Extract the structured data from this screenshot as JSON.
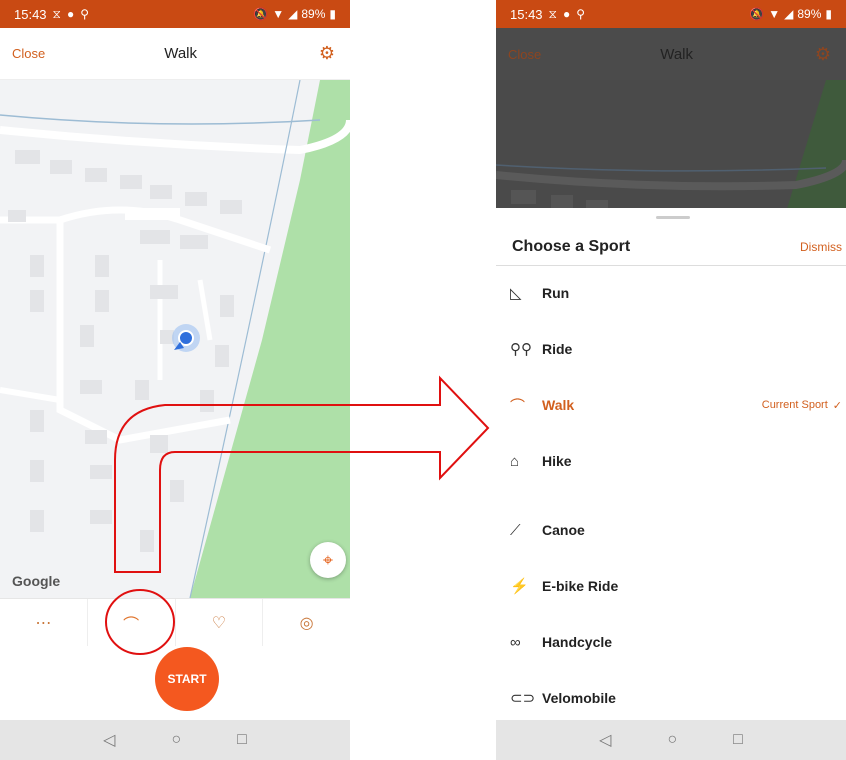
{
  "status_bar": {
    "time": "15:43",
    "battery": "89%"
  },
  "left_screen": {
    "header": {
      "close_label": "Close",
      "title": "Walk"
    },
    "map": {
      "attribution": "Google"
    },
    "start_label": "START"
  },
  "right_screen": {
    "header": {
      "close_label": "Close",
      "title": "Walk"
    },
    "sheet": {
      "title": "Choose a Sport",
      "dismiss_label": "Dismiss",
      "current_sport_label": "Current Sport",
      "sports": [
        {
          "label": "Run",
          "icon": "shoe-icon"
        },
        {
          "label": "Ride",
          "icon": "bike-icon"
        },
        {
          "label": "Walk",
          "icon": "walk-shoe-icon",
          "current": true
        },
        {
          "label": "Hike",
          "icon": "boot-icon"
        },
        {
          "label": "Canoe",
          "icon": "canoe-icon"
        },
        {
          "label": "E-bike Ride",
          "icon": "ebike-icon"
        },
        {
          "label": "Handcycle",
          "icon": "handcycle-icon"
        },
        {
          "label": "Velomobile",
          "icon": "velomobile-icon"
        }
      ]
    }
  },
  "colors": {
    "accent": "#d2601f",
    "status_bar": "#c94a13",
    "start_button": "#f4581f",
    "annotation": "#e01010"
  }
}
